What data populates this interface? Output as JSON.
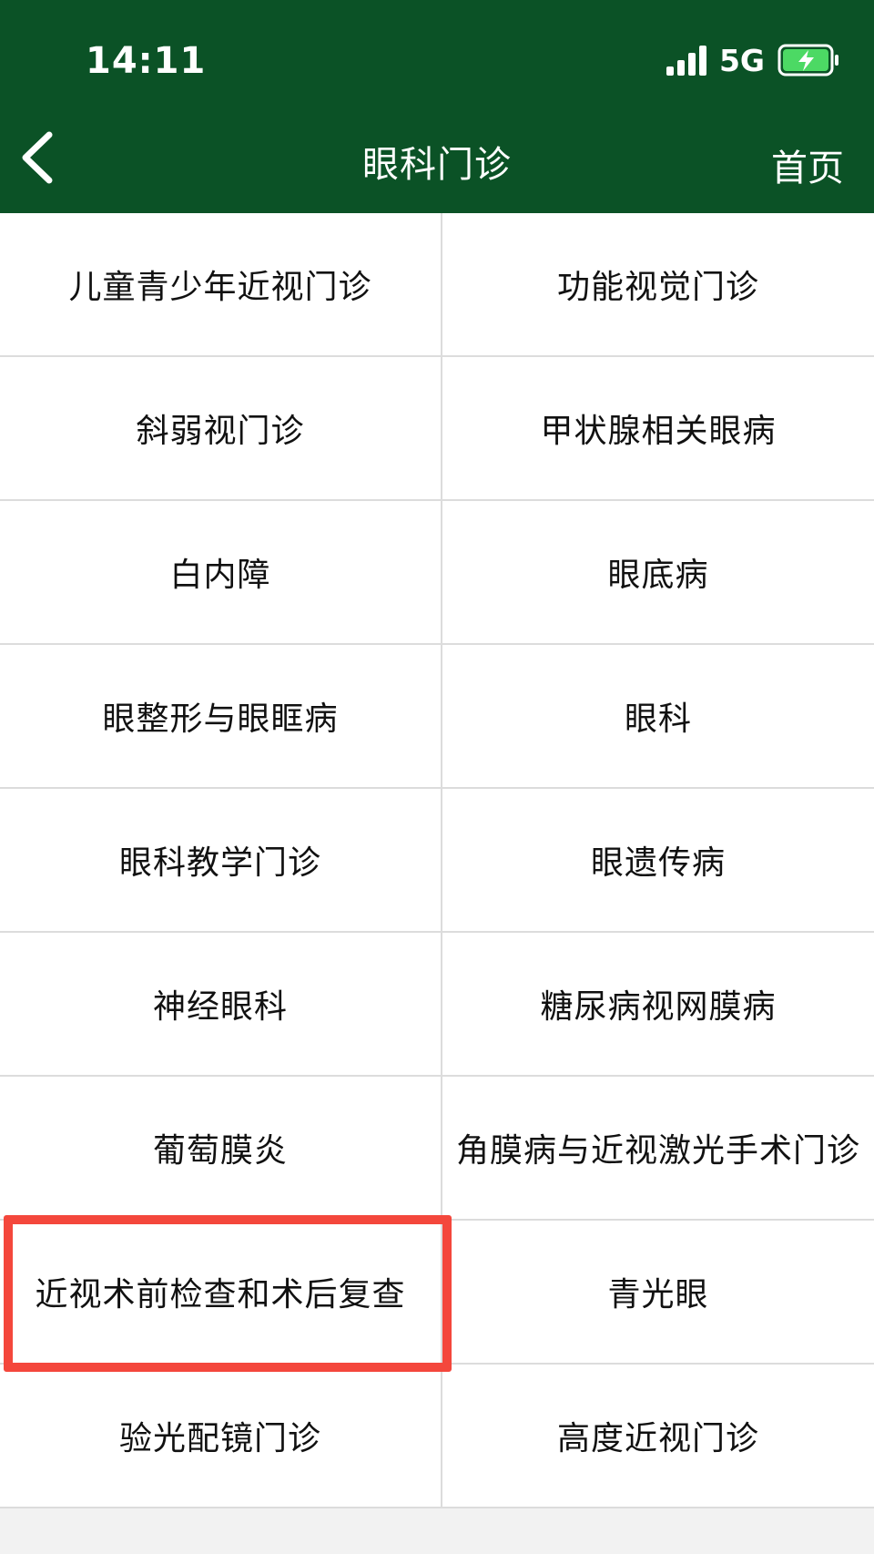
{
  "status_bar": {
    "time": "14:11",
    "network": "5G"
  },
  "nav": {
    "title": "眼科门诊",
    "home_label": "首页"
  },
  "departments": [
    "儿童青少年近视门诊",
    "功能视觉门诊",
    "斜弱视门诊",
    "甲状腺相关眼病",
    "白内障",
    "眼底病",
    "眼整形与眼眶病",
    "眼科",
    "眼科教学门诊",
    "眼遗传病",
    "神经眼科",
    "糖尿病视网膜病",
    "葡萄膜炎",
    "角膜病与近视激光手术门诊",
    "近视术前检查和术后复查",
    "青光眼",
    "验光配镜门诊",
    "高度近视门诊"
  ],
  "highlighted_item": "近视术前检查和术后复查",
  "colors": {
    "header": "#0b5226",
    "highlight": "#f4473c",
    "battery": "#4cd964"
  }
}
